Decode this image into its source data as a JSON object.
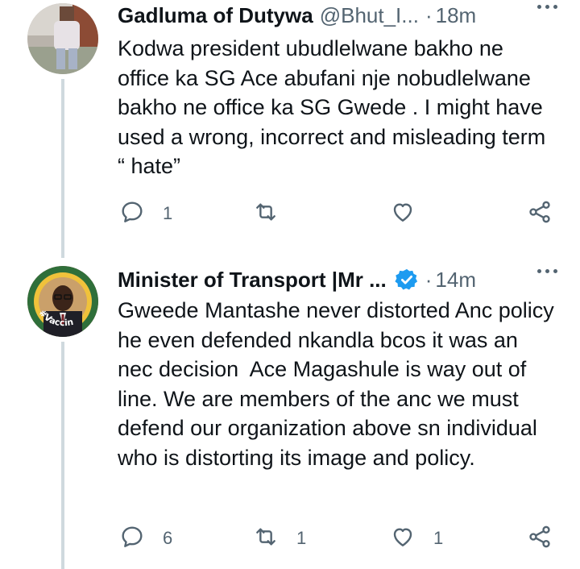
{
  "colors": {
    "text": "#0f1419",
    "muted": "#536471",
    "verified": "#1d9bf0",
    "thread_line": "#cfd9de"
  },
  "tweets": [
    {
      "name": "Gadluma of Dutywa",
      "handle": "@Bhut_I...",
      "time": "18m",
      "verified": false,
      "text": "Kodwa president ubudlelwane bakho ne office ka SG Ace abufani nje nobudlelwane bakho ne office ka SG Gwede . I might have used a wrong, incorrect and misleading term “ hate”",
      "replies": "1",
      "retweets": "",
      "likes": ""
    },
    {
      "name": "Minister of Transport |Mr ...",
      "handle": "",
      "time": "14m",
      "verified": true,
      "avatar_text": "#Vaccinate",
      "text": "Gweede Mantashe never distorted Anc policy he even defended nkandla bcos it was an nec decision  Ace Magashule is way out of line. We are members of the anc we must defend our organization above sn individual who is distorting its image and policy.",
      "replies": "6",
      "retweets": "1",
      "likes": "1"
    }
  ],
  "icons": [
    "reply-icon",
    "retweet-icon",
    "like-icon",
    "share-icon",
    "more-icon",
    "verified-icon"
  ]
}
